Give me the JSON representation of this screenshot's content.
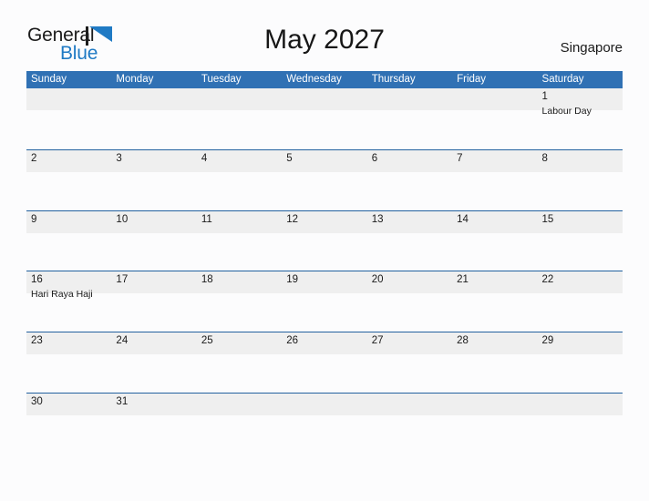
{
  "brand": {
    "name_part1": "General",
    "name_part2": "Blue",
    "flag_icon": "blue-flag-triangle",
    "color_primary": "#1f7ac4",
    "color_text": "#1c1c1c"
  },
  "header": {
    "title": "May 2027",
    "location": "Singapore"
  },
  "calendar": {
    "month": "May",
    "year": "2027",
    "colors": {
      "header_bar": "#3071b4",
      "row_divider": "#22619f",
      "week_band": "#efefef",
      "page_background": "#fcfcfd"
    },
    "weekdays": [
      "Sunday",
      "Monday",
      "Tuesday",
      "Wednesday",
      "Thursday",
      "Friday",
      "Saturday"
    ],
    "weeks": [
      [
        {
          "date": "",
          "event": ""
        },
        {
          "date": "",
          "event": ""
        },
        {
          "date": "",
          "event": ""
        },
        {
          "date": "",
          "event": ""
        },
        {
          "date": "",
          "event": ""
        },
        {
          "date": "",
          "event": ""
        },
        {
          "date": "1",
          "event": "Labour Day"
        }
      ],
      [
        {
          "date": "2",
          "event": ""
        },
        {
          "date": "3",
          "event": ""
        },
        {
          "date": "4",
          "event": ""
        },
        {
          "date": "5",
          "event": ""
        },
        {
          "date": "6",
          "event": ""
        },
        {
          "date": "7",
          "event": ""
        },
        {
          "date": "8",
          "event": ""
        }
      ],
      [
        {
          "date": "9",
          "event": ""
        },
        {
          "date": "10",
          "event": ""
        },
        {
          "date": "11",
          "event": ""
        },
        {
          "date": "12",
          "event": ""
        },
        {
          "date": "13",
          "event": ""
        },
        {
          "date": "14",
          "event": ""
        },
        {
          "date": "15",
          "event": ""
        }
      ],
      [
        {
          "date": "16",
          "event": "Hari Raya Haji"
        },
        {
          "date": "17",
          "event": ""
        },
        {
          "date": "18",
          "event": ""
        },
        {
          "date": "19",
          "event": ""
        },
        {
          "date": "20",
          "event": ""
        },
        {
          "date": "21",
          "event": ""
        },
        {
          "date": "22",
          "event": ""
        }
      ],
      [
        {
          "date": "23",
          "event": ""
        },
        {
          "date": "24",
          "event": ""
        },
        {
          "date": "25",
          "event": ""
        },
        {
          "date": "26",
          "event": ""
        },
        {
          "date": "27",
          "event": ""
        },
        {
          "date": "28",
          "event": ""
        },
        {
          "date": "29",
          "event": ""
        }
      ],
      [
        {
          "date": "30",
          "event": ""
        },
        {
          "date": "31",
          "event": ""
        },
        {
          "date": "",
          "event": ""
        },
        {
          "date": "",
          "event": ""
        },
        {
          "date": "",
          "event": ""
        },
        {
          "date": "",
          "event": ""
        },
        {
          "date": "",
          "event": ""
        }
      ]
    ]
  }
}
